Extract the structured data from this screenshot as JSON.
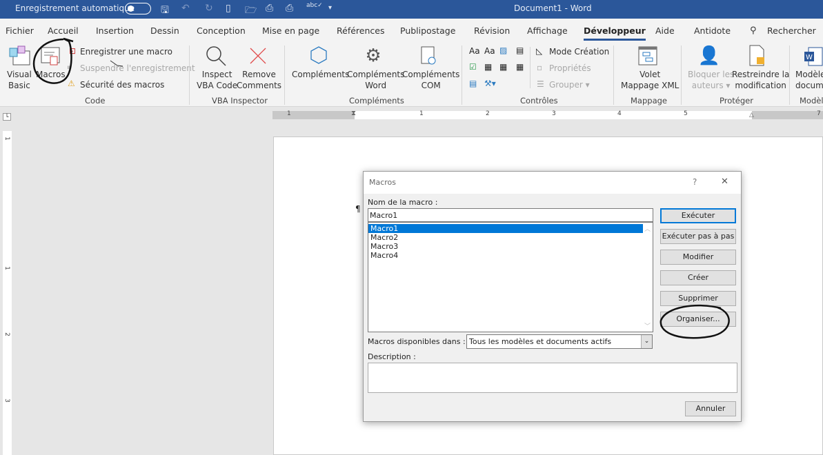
{
  "titlebar": {
    "autosave_label": "Enregistrement automatique",
    "doc_title": "Document1  -  Word",
    "qat_icons": [
      "save-icon",
      "undo-icon",
      "redo-icon",
      "new-doc-icon",
      "open-icon",
      "print-preview-icon",
      "quick-print-icon",
      "spelling-icon",
      "customize-qat-icon"
    ]
  },
  "tabs": [
    "Fichier",
    "Accueil",
    "Insertion",
    "Dessin",
    "Conception",
    "Mise en page",
    "Références",
    "Publipostage",
    "Révision",
    "Affichage",
    "Développeur",
    "Aide",
    "Antidote"
  ],
  "active_tab": "Développeur",
  "search_label": "Rechercher",
  "ribbon": {
    "code": {
      "group": "Code",
      "visual_basic": "Visual\nBasic",
      "macros": "Macros",
      "record": "Enregistrer une macro",
      "pause": "Suspendre l'enregistrement",
      "security": "Sécurité des macros"
    },
    "vba": {
      "group": "VBA Inspector",
      "inspect": [
        "Inspect",
        "VBA Code"
      ],
      "remove": [
        "Remove",
        "Comments"
      ]
    },
    "addins": {
      "group": "Compléments",
      "addins": "Compléments",
      "word": [
        "Compléments",
        "Word"
      ],
      "com": [
        "Compléments",
        "COM"
      ]
    },
    "controls": {
      "group": "Contrôles",
      "design_mode": "Mode Création",
      "properties": "Propriétés",
      "group_btn": "Grouper"
    },
    "mapping": {
      "group": "Mappage",
      "xml": [
        "Volet",
        "Mappage XML"
      ]
    },
    "protect": {
      "group": "Protéger",
      "block": [
        "Bloquer les",
        "auteurs"
      ],
      "restrict": [
        "Restreindre la",
        "modification"
      ]
    },
    "templates": {
      "group": "Modèl",
      "doc": [
        "Modèle",
        "docum"
      ]
    }
  },
  "ruler": {
    "h_numbers": [
      "1",
      "1",
      "2",
      "3",
      "4",
      "5",
      "7"
    ],
    "v_numbers": [
      "1",
      "1",
      "2",
      "3"
    ]
  },
  "document": {
    "pilcrow": "¶"
  },
  "dialog": {
    "title": "Macros",
    "help": "?",
    "close": "✕",
    "name_label": "Nom de la macro :",
    "name_value": "Macro1",
    "macros": [
      "Macro1",
      "Macro2",
      "Macro3",
      "Macro4"
    ],
    "selected": "Macro1",
    "available_label": "Macros disponibles dans :",
    "available_value": "Tous les modèles et documents actifs",
    "description_label": "Description :",
    "description_value": "",
    "buttons": {
      "run": "Exécuter",
      "step": "Exécuter pas à pas",
      "edit": "Modifier",
      "create": "Créer",
      "delete": "Supprimer",
      "organizer": "Organiser...",
      "cancel": "Annuler"
    }
  },
  "colors": {
    "titlebar": "#2b579a",
    "selection": "#0078d7",
    "annotation": "#111111"
  }
}
